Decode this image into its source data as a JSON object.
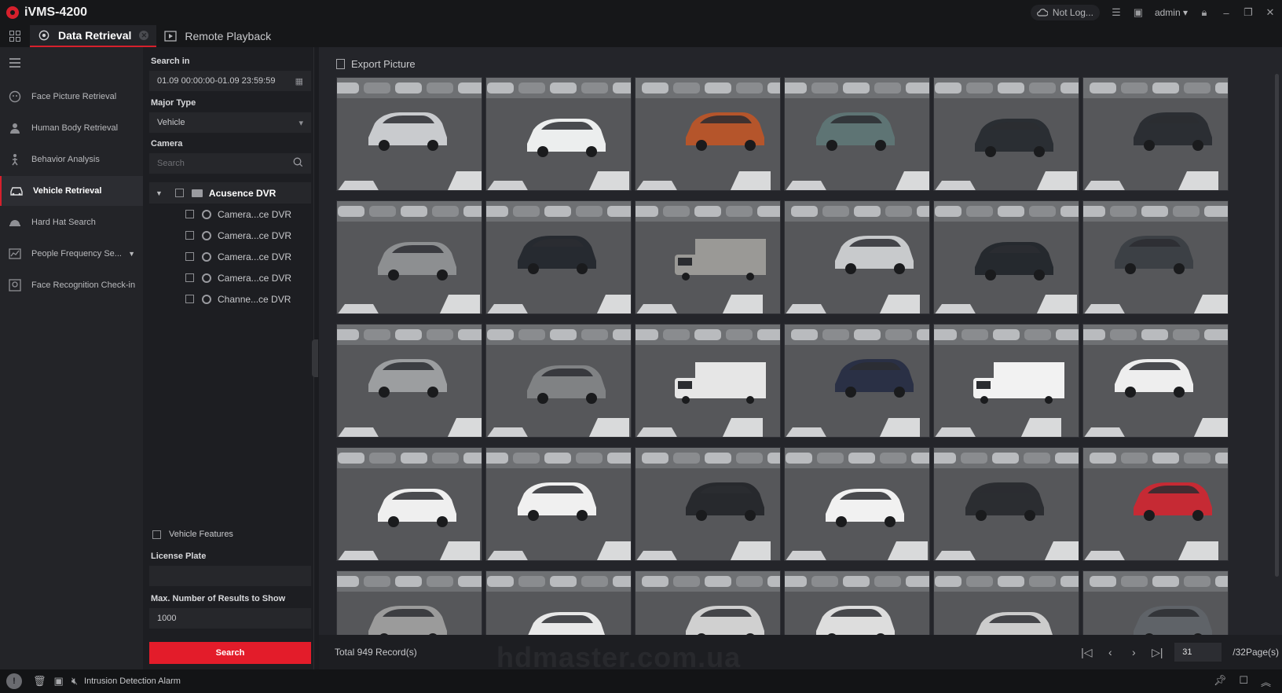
{
  "app": {
    "title": "iVMS-4200"
  },
  "titlebar": {
    "cloud_status": "Not Log...",
    "user": "admin"
  },
  "tabs": [
    {
      "label": "Data Retrieval",
      "active": true
    },
    {
      "label": "Remote Playback",
      "active": false
    }
  ],
  "nav": {
    "items": [
      {
        "label": "Face Picture Retrieval",
        "icon": "face-icon"
      },
      {
        "label": "Human Body Retrieval",
        "icon": "person-icon"
      },
      {
        "label": "Behavior Analysis",
        "icon": "behavior-icon"
      },
      {
        "label": "Vehicle Retrieval",
        "icon": "vehicle-icon",
        "active": true
      },
      {
        "label": "Hard Hat Search",
        "icon": "hardhat-icon"
      },
      {
        "label": "People Frequency Se...",
        "icon": "frequency-icon",
        "has_dropdown": true
      },
      {
        "label": "Face Recognition Check-in",
        "icon": "checkin-icon"
      }
    ]
  },
  "search": {
    "search_in_label": "Search in",
    "date_range": "01.09 00:00:00-01.09 23:59:59",
    "major_type_label": "Major Type",
    "major_type_value": "Vehicle",
    "camera_label": "Camera",
    "camera_placeholder": "Search",
    "tree": {
      "root": "Acusence DVR",
      "children": [
        "Camera...ce DVR",
        "Camera...ce DVR",
        "Camera...ce DVR",
        "Camera...ce DVR",
        "Channe...ce DVR"
      ]
    },
    "vehicle_features_label": "Vehicle Features",
    "license_plate_label": "License Plate",
    "license_plate_value": "",
    "max_results_label": "Max. Number of Results to Show",
    "max_results_value": "1000",
    "search_button": "Search"
  },
  "results": {
    "export_label": "Export Picture",
    "total": "Total 949 Record(s)",
    "current_page": "31",
    "page_total": "/32Page(s)",
    "watermark": "hdmaster.com.ua",
    "thumbnails": [
      {
        "car": "#c9cbce",
        "variant": 0
      },
      {
        "car": "#eceeee",
        "variant": 1
      },
      {
        "car": "#b5552b",
        "variant": 2
      },
      {
        "car": "#5e7474",
        "variant": 0
      },
      {
        "car": "#2a2e33",
        "variant": 1
      },
      {
        "car": "#2b2e33",
        "variant": 2
      },
      {
        "car": "#8d8f91",
        "variant": 1
      },
      {
        "car": "#262a30",
        "variant": 0
      },
      {
        "car": "#9a9996",
        "variant": 3
      },
      {
        "car": "#c8cacc",
        "variant": 2
      },
      {
        "car": "#25292e",
        "variant": 1
      },
      {
        "car": "#3c4045",
        "variant": 0
      },
      {
        "car": "#9c9ea0",
        "variant": 0
      },
      {
        "car": "#808284",
        "variant": 1
      },
      {
        "car": "#e6e6e6",
        "variant": 3
      },
      {
        "car": "#2a3045",
        "variant": 2
      },
      {
        "car": "#f2f2f2",
        "variant": 3
      },
      {
        "car": "#eeeeee",
        "variant": 0
      },
      {
        "car": "#efefef",
        "variant": 1
      },
      {
        "car": "#f0f0f0",
        "variant": 0
      },
      {
        "car": "#27292d",
        "variant": 2
      },
      {
        "car": "#f1f1f1",
        "variant": 1
      },
      {
        "car": "#2b2d31",
        "variant": 0
      },
      {
        "car": "#c62a34",
        "variant": 2
      },
      {
        "car": "#9b9b9b",
        "variant": 0
      },
      {
        "car": "#e8e8e8",
        "variant": 1
      },
      {
        "car": "#d0d0d0",
        "variant": 2
      },
      {
        "car": "#dddddd",
        "variant": 0
      },
      {
        "car": "#cccccc",
        "variant": 1
      },
      {
        "car": "#5f6368",
        "variant": 2
      }
    ]
  },
  "statusbar": {
    "alarm_text": "Intrusion Detection Alarm"
  },
  "colors": {
    "accent": "#e31c2a",
    "background": "#1b1c20",
    "panel": "#232428"
  }
}
